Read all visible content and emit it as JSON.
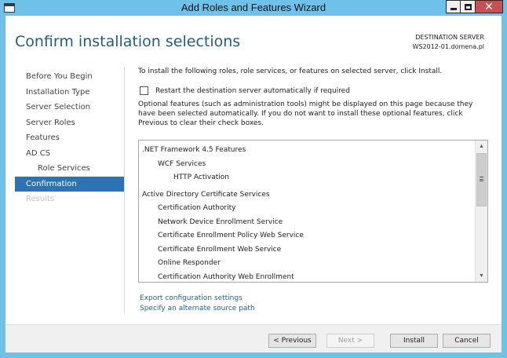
{
  "window": {
    "title": "Add Roles and Features Wizard"
  },
  "header": {
    "page_title": "Confirm installation selections",
    "destination_label": "DESTINATION SERVER",
    "destination_server": "WS2012-01.domena.pl"
  },
  "nav": {
    "items": [
      {
        "label": "Before You Begin",
        "state": "normal"
      },
      {
        "label": "Installation Type",
        "state": "normal"
      },
      {
        "label": "Server Selection",
        "state": "normal"
      },
      {
        "label": "Server Roles",
        "state": "normal"
      },
      {
        "label": "Features",
        "state": "normal"
      },
      {
        "label": "AD CS",
        "state": "normal"
      },
      {
        "label": "Role Services",
        "state": "sub"
      },
      {
        "label": "Confirmation",
        "state": "active"
      },
      {
        "label": "Results",
        "state": "disabled"
      }
    ]
  },
  "content": {
    "intro": "To install the following roles, role services, or features on selected server, click Install.",
    "restart_label": "Restart the destination server automatically if required",
    "restart_checked": false,
    "optional_text": "Optional features (such as administration tools) might be displayed on this page because they have been selected automatically. If you do not want to install these optional features, click Previous to clear their check boxes.",
    "selections": [
      {
        "label": ".NET Framework 4.5 Features",
        "level": 0
      },
      {
        "label": "WCF Services",
        "level": 1
      },
      {
        "label": "HTTP Activation",
        "level": 2
      },
      {
        "label": "Active Directory Certificate Services",
        "level": 0
      },
      {
        "label": "Certification Authority",
        "level": 1
      },
      {
        "label": "Network Device Enrollment Service",
        "level": 1
      },
      {
        "label": "Certificate Enrollment Policy Web Service",
        "level": 1
      },
      {
        "label": "Certificate Enrollment Web Service",
        "level": 1
      },
      {
        "label": "Online Responder",
        "level": 1
      },
      {
        "label": "Certification Authority Web Enrollment",
        "level": 1
      }
    ],
    "links": {
      "export": "Export configuration settings",
      "alternate_source": "Specify an alternate source path"
    }
  },
  "footer": {
    "previous_label": "< Previous",
    "next_label": "Next >",
    "install_label": "Install",
    "cancel_label": "Cancel"
  },
  "colors": {
    "title_bar": "#6ec2e9",
    "accent": "#2b73b5",
    "page_title": "#1e5e86",
    "close_button": "#c75050"
  },
  "icons": {
    "window": "server-manager-icon",
    "minimize": "minimize-icon",
    "maximize": "maximize-icon",
    "close": "close-icon",
    "scroll_up": "chevron-up-icon",
    "scroll_down": "chevron-down-icon"
  }
}
